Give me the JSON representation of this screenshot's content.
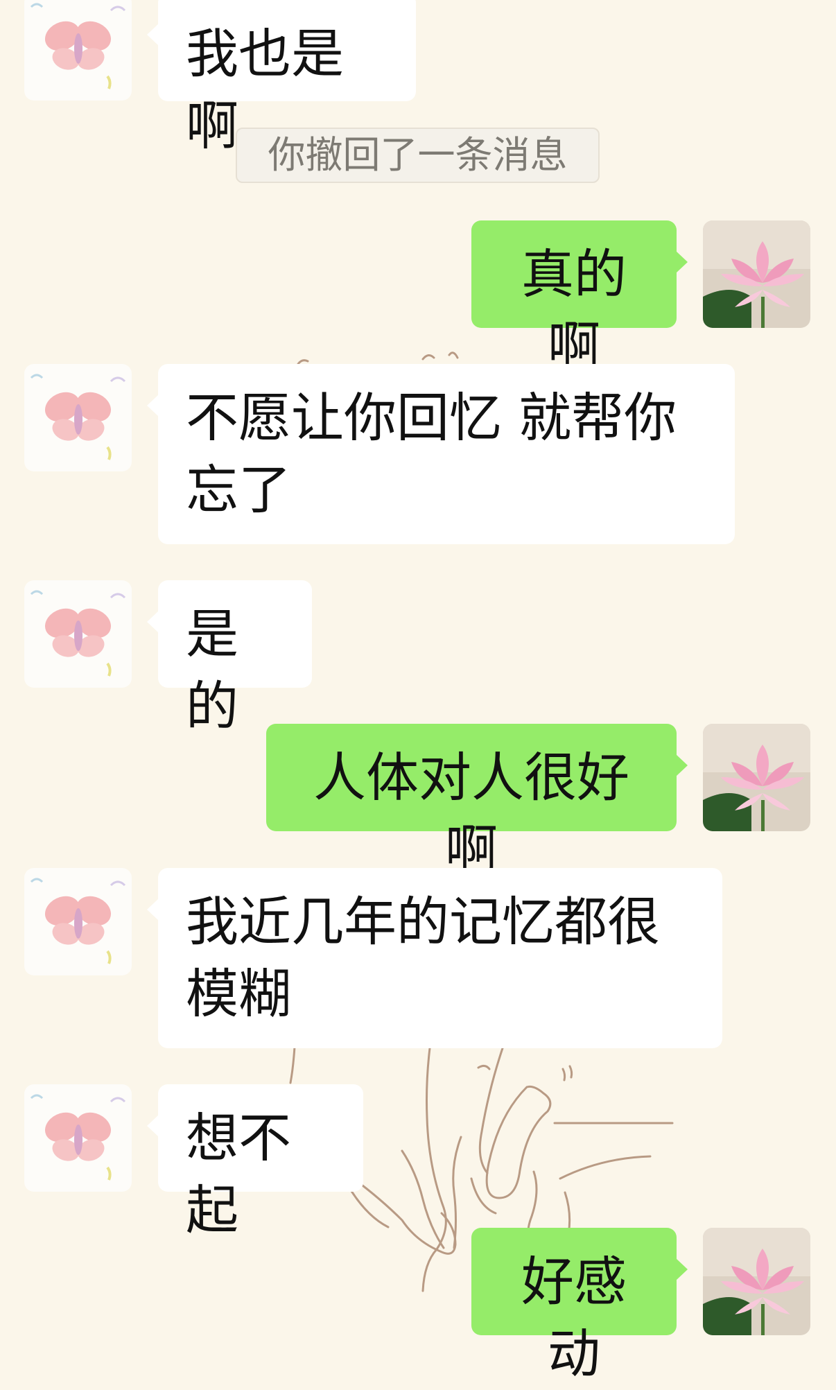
{
  "system_notice": "你撤回了一条消息",
  "messages": [
    {
      "side": "in",
      "text": "我也是啊"
    },
    {
      "side": "out",
      "text": "真的啊"
    },
    {
      "side": "in",
      "text": "不愿让你回忆 就帮你忘了"
    },
    {
      "side": "in",
      "text": "是的"
    },
    {
      "side": "out",
      "text": "人体对人很好啊"
    },
    {
      "side": "in",
      "text": "我近几年的记忆都很模糊"
    },
    {
      "side": "in",
      "text": "想不起"
    },
    {
      "side": "out",
      "text": "好感动"
    }
  ],
  "avatars": {
    "contact": "butterfly-avatar",
    "self": "lotus-avatar"
  },
  "colors": {
    "background": "#fbf6ea",
    "incoming_bubble": "#ffffff",
    "outgoing_bubble": "#95ec69",
    "notice_text": "#7d7a73"
  }
}
